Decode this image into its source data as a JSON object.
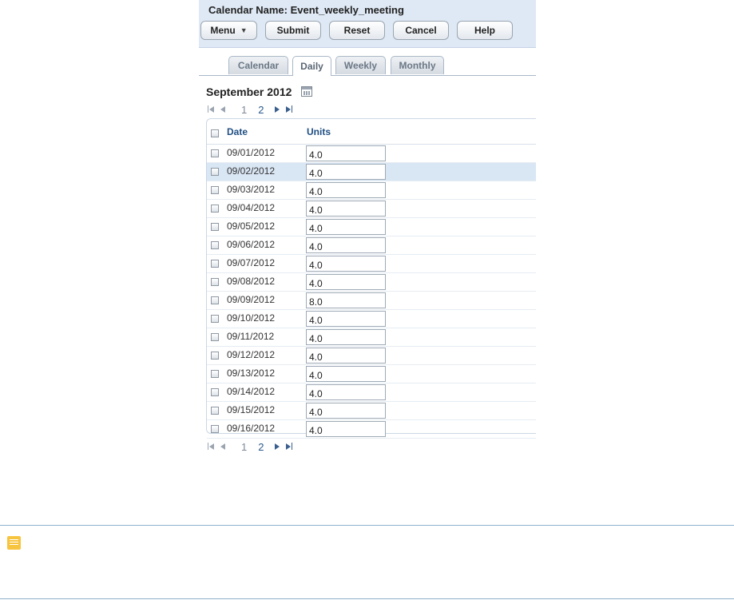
{
  "header": {
    "title": "Calendar Name: Event_weekly_meeting",
    "buttons": {
      "menu": "Menu",
      "submit": "Submit",
      "reset": "Reset",
      "cancel": "Cancel",
      "help": "Help"
    }
  },
  "tabs": [
    {
      "label": "Calendar",
      "active": false
    },
    {
      "label": "Daily",
      "active": true
    },
    {
      "label": "Weekly",
      "active": false
    },
    {
      "label": "Monthly",
      "active": false
    }
  ],
  "month_title": "September 2012",
  "pager": {
    "current_page": "1",
    "next_page": "2"
  },
  "grid": {
    "columns": {
      "date": "Date",
      "units": "Units"
    },
    "selected_row": "09/02/2012",
    "rows": [
      {
        "date": "09/01/2012",
        "units": "4.0"
      },
      {
        "date": "09/02/2012",
        "units": "4.0"
      },
      {
        "date": "09/03/2012",
        "units": "4.0"
      },
      {
        "date": "09/04/2012",
        "units": "4.0"
      },
      {
        "date": "09/05/2012",
        "units": "4.0"
      },
      {
        "date": "09/06/2012",
        "units": "4.0"
      },
      {
        "date": "09/07/2012",
        "units": "4.0"
      },
      {
        "date": "09/08/2012",
        "units": "4.0"
      },
      {
        "date": "09/09/2012",
        "units": "8.0"
      },
      {
        "date": "09/10/2012",
        "units": "4.0"
      },
      {
        "date": "09/11/2012",
        "units": "4.0"
      },
      {
        "date": "09/12/2012",
        "units": "4.0"
      },
      {
        "date": "09/13/2012",
        "units": "4.0"
      },
      {
        "date": "09/14/2012",
        "units": "4.0"
      },
      {
        "date": "09/15/2012",
        "units": "4.0"
      },
      {
        "date": "09/16/2012",
        "units": "4.0"
      }
    ]
  },
  "colors": {
    "header_bg": "#dfe9f5",
    "link_blue": "#1f4e82",
    "selected_row": "#d9e6f4",
    "note_icon": "#f7c43f"
  },
  "icons": {
    "calendar_picker": "calendar-icon",
    "note": "note-icon"
  }
}
